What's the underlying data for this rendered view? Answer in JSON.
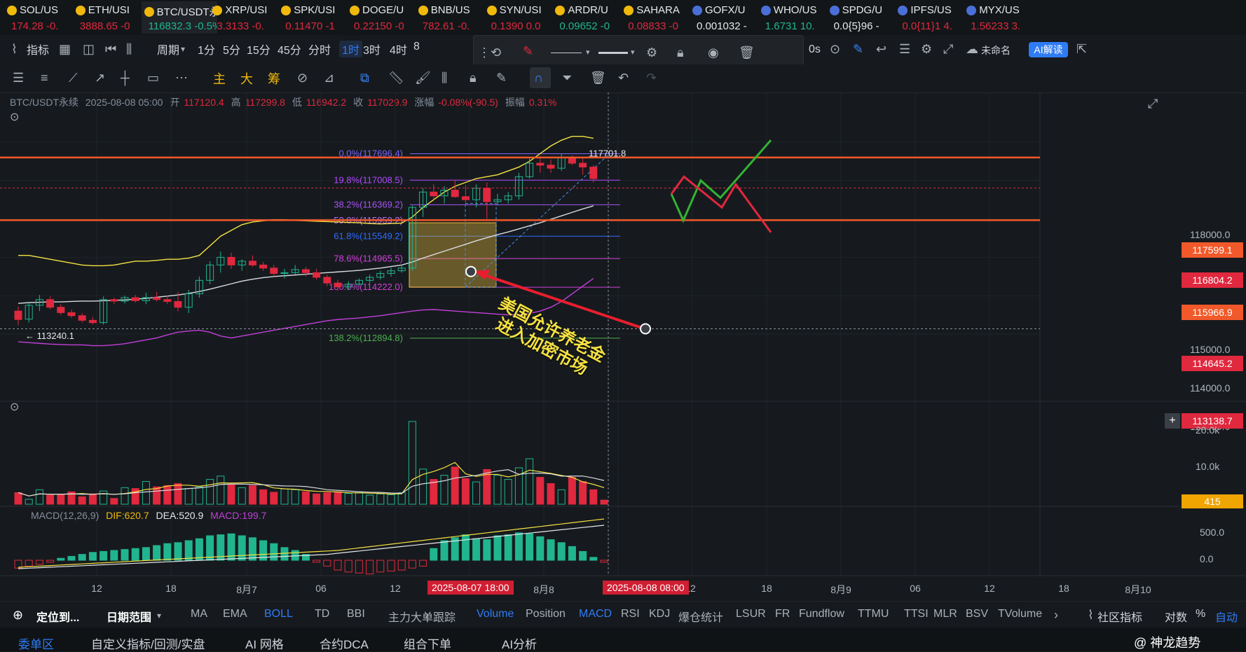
{
  "tickers": [
    {
      "name": "SOL/US",
      "price": "174.28 -0.",
      "up": false
    },
    {
      "name": "ETH/USI",
      "price": "3888.65 -0",
      "up": false
    },
    {
      "name": "BTC/USDT永续",
      "price": "116832.3 -0.5%",
      "up": true,
      "selected": true
    },
    {
      "name": "XRP/USI",
      "price": "3.3133 -0.",
      "up": false
    },
    {
      "name": "SPK/USI",
      "price": "0.11470 -1",
      "up": false
    },
    {
      "name": "DOGE/U",
      "price": "0.22150 -0",
      "up": false
    },
    {
      "name": "BNB/US",
      "price": "782.61 -0.",
      "up": false
    },
    {
      "name": "SYN/USI",
      "price": "0.1390 0.0",
      "up": false
    },
    {
      "name": "ARDR/U",
      "price": "0.09652 -0",
      "up": true
    },
    {
      "name": "SAHARA",
      "price": "0.08833 -0",
      "up": false
    },
    {
      "name": "GOFX/U",
      "price": "0.001032 -",
      "up": null
    },
    {
      "name": "WHO/US",
      "price": "1.6731 10.",
      "up": true
    },
    {
      "name": "SPDG/U",
      "price": "0.0{5}96 -",
      "up": null
    },
    {
      "name": "IPFS/US",
      "price": "0.0{11}1 4.",
      "up": false
    },
    {
      "name": "MYX/US",
      "price": "1.56233 3.",
      "up": false
    }
  ],
  "toolbar": {
    "indicators": "指标",
    "period": "周期",
    "intervals": [
      "1分",
      "5分",
      "15分",
      "45分",
      "分时",
      "1时",
      "3时",
      "4时",
      "8"
    ],
    "active_interval": "1时",
    "seconds": "0s",
    "layout_name": "未命名",
    "ai_button": "AI解读"
  },
  "drawing_tools": {
    "main": "主",
    "big": "大",
    "chips": "筹"
  },
  "legend": {
    "symbol": "BTC/USDT永续",
    "datetime": "2025-08-08 05:00",
    "open_label": "开",
    "open": "117120.4",
    "high_label": "高",
    "high": "117299.8",
    "low_label": "低",
    "low": "116942.2",
    "close_label": "收",
    "close": "117029.9",
    "change_label": "涨幅",
    "change": "-0.08%(-90.5)",
    "amp_label": "振幅",
    "amp": "0.31%"
  },
  "chart_data": {
    "type": "candlestick",
    "price_axis": {
      "ticks": [
        "118000.0",
        "115000.0",
        "114000.0",
        "113000.0"
      ],
      "ylim": [
        112400,
        118600
      ]
    },
    "price_labels": [
      {
        "value": "117599.1",
        "color": "#f1592a"
      },
      {
        "value": "116804.2",
        "color": "#e0283e"
      },
      {
        "value": "115966.9",
        "color": "#f1592a"
      },
      {
        "value": "114645.2",
        "color": "#e0283e"
      },
      {
        "value": "113138.7",
        "color": "#e0283e"
      }
    ],
    "hlines": [
      117599.1,
      115966.9
    ],
    "series": [
      {
        "name": "candles",
        "ohlc": [
          [
            113600,
            113720,
            113230,
            113380
          ],
          [
            113390,
            113820,
            113300,
            113750
          ],
          [
            113750,
            114020,
            113600,
            113900
          ],
          [
            113900,
            113980,
            113650,
            113700
          ],
          [
            113700,
            113780,
            113500,
            113560
          ],
          [
            113560,
            113640,
            113420,
            113480
          ],
          [
            113480,
            113550,
            113300,
            113360
          ],
          [
            113360,
            113450,
            113250,
            113300
          ],
          [
            113300,
            113980,
            113250,
            113900
          ],
          [
            113900,
            113950,
            113780,
            113860
          ],
          [
            113860,
            114000,
            113800,
            113950
          ],
          [
            113950,
            114020,
            113820,
            113870
          ],
          [
            113870,
            114080,
            113780,
            113950
          ],
          [
            113950,
            114100,
            113850,
            113900
          ],
          [
            113900,
            114000,
            113780,
            113850
          ],
          [
            113850,
            114100,
            113600,
            113700
          ],
          [
            113700,
            114150,
            113550,
            114050
          ],
          [
            114050,
            114500,
            113950,
            114400
          ],
          [
            114400,
            114900,
            114300,
            114800
          ],
          [
            114800,
            115150,
            114600,
            115000
          ],
          [
            115000,
            115120,
            114700,
            114800
          ],
          [
            114800,
            114950,
            114650,
            114900
          ],
          [
            114900,
            115050,
            114750,
            114800
          ],
          [
            114800,
            114880,
            114650,
            114720
          ],
          [
            114720,
            114800,
            114500,
            114580
          ],
          [
            114580,
            114700,
            114450,
            114600
          ],
          [
            114600,
            114800,
            114550,
            114680
          ],
          [
            114680,
            114750,
            114500,
            114600
          ],
          [
            114600,
            114700,
            114420,
            114480
          ],
          [
            114480,
            114550,
            114250,
            114330
          ],
          [
            114330,
            114420,
            114130,
            114230
          ],
          [
            114230,
            114380,
            114150,
            114300
          ],
          [
            114300,
            114450,
            114250,
            114400
          ],
          [
            114400,
            114550,
            114320,
            114480
          ],
          [
            114480,
            114650,
            114420,
            114580
          ],
          [
            114580,
            114730,
            114500,
            114650
          ],
          [
            114650,
            114800,
            114600,
            114720
          ],
          [
            114720,
            116350,
            114650,
            116300
          ],
          [
            116300,
            116800,
            116050,
            116700
          ],
          [
            116700,
            116900,
            116500,
            116600
          ],
          [
            116600,
            116850,
            116400,
            116750
          ],
          [
            116750,
            117000,
            116550,
            116580
          ],
          [
            116580,
            116880,
            116400,
            116500
          ],
          [
            116500,
            116900,
            116300,
            116800
          ],
          [
            116800,
            116950,
            116000,
            116450
          ],
          [
            116450,
            116650,
            116350,
            116500
          ],
          [
            116500,
            116700,
            116400,
            116600
          ],
          [
            116600,
            117200,
            116500,
            117100
          ],
          [
            117100,
            117600,
            117050,
            117450
          ],
          [
            117450,
            117650,
            117200,
            117400
          ],
          [
            117400,
            117550,
            117200,
            117320
          ],
          [
            117320,
            117700,
            117250,
            117600
          ],
          [
            117600,
            117650,
            117400,
            117450
          ],
          [
            117450,
            117580,
            117150,
            117350
          ],
          [
            117350,
            117400,
            116950,
            117050
          ]
        ]
      },
      {
        "name": "BOLL-upper",
        "values": [
          115050,
          115050,
          115000,
          114950,
          114900,
          114850,
          114800,
          114780,
          114780,
          114800,
          114850,
          114900,
          114900,
          114920,
          114950,
          114950,
          114980,
          115050,
          115300,
          115550,
          115700,
          115850,
          115920,
          115950,
          115980,
          115980,
          115960,
          115950,
          115940,
          115930,
          115920,
          115910,
          115900,
          115880,
          115870,
          115880,
          115890,
          116050,
          116300,
          116500,
          116700,
          116850,
          116950,
          117050,
          117100,
          117150,
          117250,
          117350,
          117500,
          117700,
          117900,
          118050,
          118150,
          118150,
          118100
        ]
      },
      {
        "name": "BOLL-mid",
        "values": [
          113800,
          113820,
          113830,
          113840,
          113840,
          113850,
          113860,
          113860,
          113870,
          113880,
          113890,
          113910,
          113930,
          113960,
          113990,
          114020,
          114060,
          114110,
          114170,
          114240,
          114310,
          114380,
          114430,
          114470,
          114500,
          114520,
          114540,
          114560,
          114580,
          114600,
          114620,
          114640,
          114660,
          114690,
          114720,
          114760,
          114800,
          114880,
          114980,
          115070,
          115160,
          115250,
          115340,
          115430,
          115510,
          115590,
          115660,
          115740,
          115820,
          115900,
          115990,
          116080,
          116170,
          116260,
          116340
        ]
      },
      {
        "name": "BOLL-lower",
        "values": [
          112800,
          112780,
          112760,
          112740,
          112730,
          112720,
          112720,
          112700,
          112700,
          112720,
          112750,
          112800,
          112850,
          112900,
          112980,
          113050,
          113080,
          113100,
          113050,
          112950,
          112900,
          112950,
          113000,
          113050,
          113100,
          113150,
          113200,
          113250,
          113300,
          113350,
          113380,
          113400,
          113420,
          113450,
          113480,
          113520,
          113560,
          113600,
          113630,
          113640,
          113620,
          113600,
          113580,
          113560,
          113540,
          113520,
          113500,
          113500,
          113540,
          113600,
          113700,
          113850,
          114050,
          114250,
          114450
        ]
      }
    ],
    "fib_levels": [
      {
        "label": "0.0%(117696.4)",
        "value": 117696.4,
        "color": "#7b61ff"
      },
      {
        "label": "19.8%(117008.5)",
        "value": 117008.5,
        "color": "#b048ff"
      },
      {
        "label": "38.2%(116369.2)",
        "value": 116369.2,
        "color": "#a855f7"
      },
      {
        "label": "50.0%(115959.2)",
        "value": 115959.2,
        "color": "#c06cff"
      },
      {
        "label": "61.8%(115549.2)",
        "value": 115549.2,
        "color": "#2f6bff"
      },
      {
        "label": "78.6%(114965.5)",
        "value": 114965.5,
        "color": "#d23fd9"
      },
      {
        "label": "100.0%(114222.0)",
        "value": 114222.0,
        "color": "#d23fd9"
      },
      {
        "label": "138.2%(112894.8)",
        "value": 112894.8,
        "color": "#4caf50"
      }
    ],
    "low_marker": "← 113240.1",
    "high_marker": "117701.8",
    "volume": {
      "ticks": [
        "20.0k",
        "10.0k"
      ],
      "current": "415",
      "values": [
        2800,
        1200,
        3500,
        2200,
        2400,
        3000,
        1800,
        2500,
        3200,
        1400,
        4000,
        3800,
        5500,
        4200,
        4500,
        5000,
        3800,
        4200,
        6000,
        6800,
        4800,
        4000,
        4500,
        3500,
        2900,
        3700,
        3500,
        3000,
        2500,
        2800,
        3000,
        2600,
        2800,
        2200,
        2500,
        2300,
        2800,
        20000,
        8500,
        6000,
        7000,
        9000,
        6200,
        5400,
        8400,
        7000,
        6000,
        8800,
        11000,
        6500,
        5000,
        3500,
        6500,
        5500,
        3500,
        1000
      ]
    },
    "macd": {
      "label": "MACD(12,26,9)",
      "dif_label": "DIF:",
      "dif": "620.7",
      "dea_label": "DEA:",
      "dea": "520.9",
      "macd_label": "MACD:",
      "macd": "199.7",
      "ticks": [
        "500.0",
        "0.0"
      ],
      "hist": [
        -80,
        -60,
        -40,
        -20,
        20,
        40,
        60,
        80,
        90,
        100,
        110,
        120,
        130,
        150,
        170,
        180,
        200,
        220,
        250,
        260,
        270,
        250,
        230,
        200,
        170,
        130,
        100,
        60,
        -20,
        -60,
        -100,
        -120,
        -130,
        -140,
        -120,
        -110,
        -100,
        -80,
        -60,
        120,
        200,
        230,
        260,
        220,
        210,
        250,
        260,
        280,
        270,
        240,
        210,
        180,
        140,
        90,
        30,
        -20
      ]
    },
    "x_ticks": [
      "12",
      "18",
      "8月7",
      "06",
      "12",
      "18",
      "8月8",
      "12",
      "18",
      "8月9",
      "06",
      "12",
      "18",
      "8月10"
    ],
    "x_highlight": [
      "2025-08-07 18:00",
      "2025-08-08 08:00"
    ],
    "annotation": [
      "美国允许养老金",
      "进入加密市场"
    ]
  },
  "bottom_toolbar": {
    "locate": "定位到...",
    "date_range": "日期范围",
    "main_indicators": [
      "MA",
      "EMA",
      "BOLL",
      "TD",
      "BBI",
      "主力大单跟踪"
    ],
    "sub_indicators": [
      "Volume",
      "Position",
      "MACD",
      "RSI",
      "KDJ",
      "爆仓统计",
      "LSUR",
      "FR",
      "Fundflow",
      "TTMU",
      "TTSI",
      "MLR",
      "BSV",
      "TVolume"
    ],
    "community": "社区指标",
    "log": "对数",
    "pct": "%",
    "auto": "自动"
  },
  "footer": {
    "tabs": [
      "委单区",
      "自定义指标/回测/实盘",
      "AI 网格",
      "合约DCA",
      "组合下单",
      "AI分析"
    ],
    "brand": "@ 神龙趋势"
  },
  "colors": {
    "up": "#21b58f",
    "down": "#e0283e",
    "accent": "#2f7bf5",
    "orange": "#f1592a",
    "zone": "#f0c040"
  }
}
